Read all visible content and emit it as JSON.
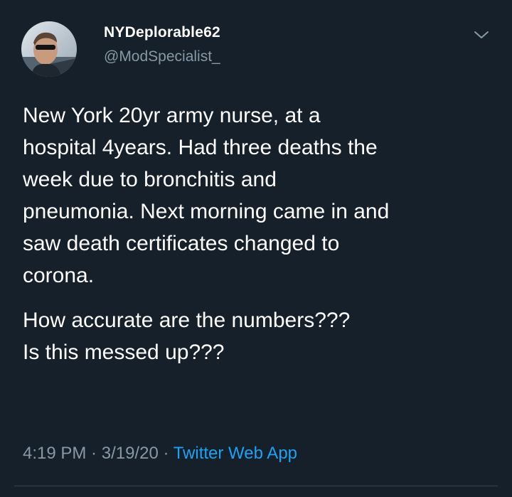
{
  "user": {
    "name": "NYDeplorable62",
    "handle": "@ModSpecialist_"
  },
  "tweet": {
    "paragraph1": [
      "New York 20yr army nurse, at a",
      "hospital 4years.  Had three deaths the",
      "week due to bronchitis and",
      "pneumonia.  Next morning came in and",
      "saw death certificates changed to",
      "corona."
    ],
    "paragraph2": [
      "How accurate are the numbers???",
      "Is this messed up???"
    ]
  },
  "meta": {
    "time": "4:19 PM",
    "separator": " · ",
    "date": "3/19/20",
    "source": "Twitter Web App"
  },
  "icons": {
    "menu": "chevron-down-icon"
  },
  "colors": {
    "background": "#15202b",
    "text": "#ffffff",
    "secondary": "#8899a6",
    "link": "#1da1f2"
  }
}
